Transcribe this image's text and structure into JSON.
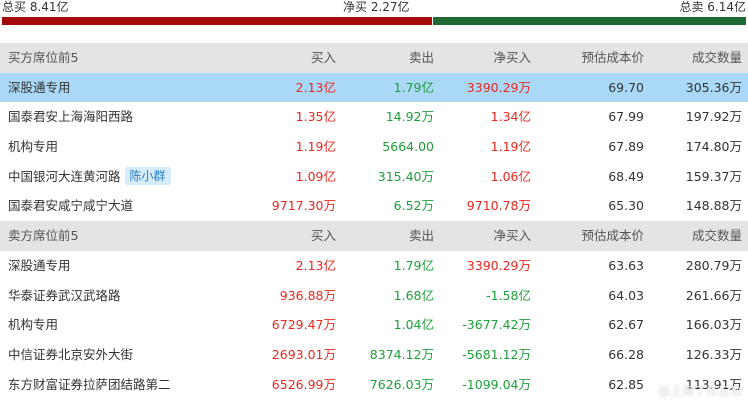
{
  "summary": {
    "total_buy": "总买 8.41亿",
    "net_buy": "净买 2.27亿",
    "total_sell": "总卖 6.14亿"
  },
  "buy_section": {
    "header": [
      "买方席位前5",
      "买入",
      "卖出",
      "净买入",
      "预估成本价",
      "成交数量"
    ],
    "rows": [
      {
        "seat": "深股通专用",
        "buy": "2.13亿",
        "sell": "1.79亿",
        "net": "3390.29万",
        "cost": "69.70",
        "volume": "305.36万",
        "tag": ""
      },
      {
        "seat": "国泰君安上海海阳西路",
        "buy": "1.35亿",
        "sell": "14.92万",
        "net": "1.34亿",
        "cost": "67.99",
        "volume": "197.92万",
        "tag": ""
      },
      {
        "seat": "机构专用",
        "buy": "1.19亿",
        "sell": "5664.00",
        "net": "1.19亿",
        "cost": "67.89",
        "volume": "174.80万",
        "tag": ""
      },
      {
        "seat": "中国银河大连黄河路",
        "buy": "1.09亿",
        "sell": "315.40万",
        "net": "1.06亿",
        "cost": "68.49",
        "volume": "159.37万",
        "tag": "陈小群"
      },
      {
        "seat": "国泰君安咸宁咸宁大道",
        "buy": "9717.30万",
        "sell": "6.52万",
        "net": "9710.78万",
        "cost": "65.30",
        "volume": "148.88万",
        "tag": ""
      }
    ]
  },
  "sell_section": {
    "header": [
      "卖方席位前5",
      "买入",
      "卖出",
      "净买入",
      "预估成本价",
      "成交数量"
    ],
    "rows": [
      {
        "seat": "深股通专用",
        "buy": "2.13亿",
        "sell": "1.79亿",
        "net": "3390.29万",
        "cost": "63.63",
        "volume": "280.79万"
      },
      {
        "seat": "华泰证券武汉武珞路",
        "buy": "936.88万",
        "sell": "1.68亿",
        "net": "-1.58亿",
        "cost": "64.03",
        "volume": "261.66万"
      },
      {
        "seat": "机构专用",
        "buy": "6729.47万",
        "sell": "1.04亿",
        "net": "-3677.42万",
        "cost": "62.67",
        "volume": "166.03万"
      },
      {
        "seat": "中信证券北京安外大街",
        "buy": "2693.01万",
        "sell": "8374.12万",
        "net": "-5681.12万",
        "cost": "66.28",
        "volume": "126.33万"
      },
      {
        "seat": "东方财富证券拉萨团结路第二",
        "buy": "6526.99万",
        "sell": "7626.03万",
        "net": "-1099.04万",
        "cost": "62.85",
        "volume": "113.91万"
      }
    ]
  },
  "watermark": "@上海丁市五功",
  "colors": {
    "up": "#e8281f",
    "down": "#1f9e3a",
    "buy_bar": "#a50a0a",
    "sell_bar": "#1f6a34",
    "highlight": "#aad9f7"
  }
}
